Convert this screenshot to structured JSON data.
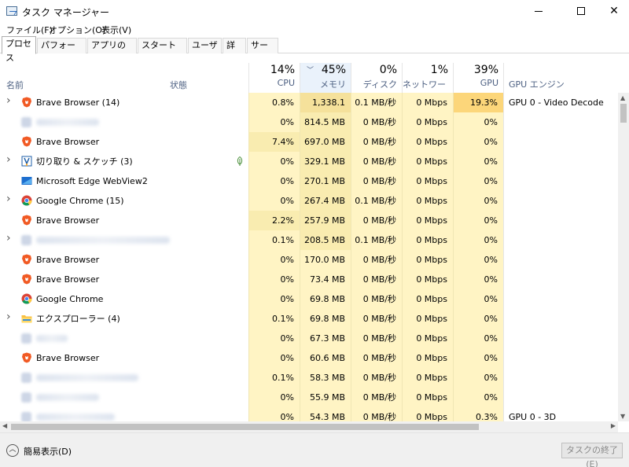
{
  "window": {
    "title": "タスク マネージャー"
  },
  "menu": [
    "ファイル(F)",
    "オプション(O)",
    "表示(V)"
  ],
  "tabs": [
    "プロセス",
    "パフォーマンス",
    "アプリの履歴",
    "スタートアップ",
    "ユーザー",
    "詳細",
    "サービス"
  ],
  "header": {
    "name": "名前",
    "status": "状態",
    "cpu": {
      "pct": "14%",
      "label": "CPU"
    },
    "memory": {
      "pct": "45%",
      "label": "メモリ"
    },
    "disk": {
      "pct": "0%",
      "label": "ディスク"
    },
    "network": {
      "pct": "1%",
      "label": "ネットワーク"
    },
    "gpu": {
      "pct": "39%",
      "label": "GPU"
    },
    "gpu_engine": {
      "label": "GPU エンジン"
    }
  },
  "rows": [
    {
      "name": "Brave Browser (14)",
      "icon": "brave-icon",
      "expand": true,
      "cpu": "0.8%",
      "mem": "1,338.1 MB",
      "disk": "0.1 MB/秒",
      "net": "0 Mbps",
      "gpu": "19.3%",
      "engine": "GPU 0 - Video Decode"
    },
    {
      "name": "",
      "icon": "blurred-icon",
      "expand": false,
      "cpu": "0%",
      "mem": "814.5 MB",
      "disk": "0 MB/秒",
      "net": "0 Mbps",
      "gpu": "0%",
      "engine": ""
    },
    {
      "name": "Brave Browser",
      "icon": "brave-icon",
      "expand": false,
      "cpu": "7.4%",
      "mem": "697.0 MB",
      "disk": "0 MB/秒",
      "net": "0 Mbps",
      "gpu": "0%",
      "engine": ""
    },
    {
      "name": "切り取り & スケッチ (3)",
      "icon": "snip-sketch-icon",
      "expand": true,
      "cpu": "0%",
      "mem": "329.1 MB",
      "disk": "0 MB/秒",
      "net": "0 Mbps",
      "gpu": "0%",
      "engine": ""
    },
    {
      "name": "Microsoft Edge WebView2",
      "icon": "edge-webview-icon",
      "expand": false,
      "cpu": "0%",
      "mem": "270.1 MB",
      "disk": "0 MB/秒",
      "net": "0 Mbps",
      "gpu": "0%",
      "engine": ""
    },
    {
      "name": "Google Chrome (15)",
      "icon": "chrome-icon",
      "expand": true,
      "cpu": "0%",
      "mem": "267.4 MB",
      "disk": "0.1 MB/秒",
      "net": "0 Mbps",
      "gpu": "0%",
      "engine": ""
    },
    {
      "name": "Brave Browser",
      "icon": "brave-icon",
      "expand": false,
      "cpu": "2.2%",
      "mem": "257.9 MB",
      "disk": "0 MB/秒",
      "net": "0 Mbps",
      "gpu": "0%",
      "engine": ""
    },
    {
      "name": "",
      "icon": "blurred-icon",
      "expand": true,
      "cpu": "0.1%",
      "mem": "208.5 MB",
      "disk": "0.1 MB/秒",
      "net": "0 Mbps",
      "gpu": "0%",
      "engine": ""
    },
    {
      "name": "Brave Browser",
      "icon": "brave-icon",
      "expand": false,
      "cpu": "0%",
      "mem": "170.0 MB",
      "disk": "0 MB/秒",
      "net": "0 Mbps",
      "gpu": "0%",
      "engine": ""
    },
    {
      "name": "Brave Browser",
      "icon": "brave-icon",
      "expand": false,
      "cpu": "0%",
      "mem": "73.4 MB",
      "disk": "0 MB/秒",
      "net": "0 Mbps",
      "gpu": "0%",
      "engine": ""
    },
    {
      "name": "Google Chrome",
      "icon": "chrome-icon",
      "expand": false,
      "cpu": "0%",
      "mem": "69.8 MB",
      "disk": "0 MB/秒",
      "net": "0 Mbps",
      "gpu": "0%",
      "engine": ""
    },
    {
      "name": "エクスプローラー (4)",
      "icon": "explorer-icon",
      "expand": true,
      "cpu": "0.1%",
      "mem": "69.8 MB",
      "disk": "0 MB/秒",
      "net": "0 Mbps",
      "gpu": "0%",
      "engine": ""
    },
    {
      "name": "",
      "icon": "blurred-icon",
      "expand": false,
      "cpu": "0%",
      "mem": "67.3 MB",
      "disk": "0 MB/秒",
      "net": "0 Mbps",
      "gpu": "0%",
      "engine": ""
    },
    {
      "name": "Brave Browser",
      "icon": "brave-icon",
      "expand": false,
      "cpu": "0%",
      "mem": "60.6 MB",
      "disk": "0 MB/秒",
      "net": "0 Mbps",
      "gpu": "0%",
      "engine": ""
    },
    {
      "name": "",
      "icon": "blurred-icon",
      "expand": false,
      "cpu": "0.1%",
      "mem": "58.3 MB",
      "disk": "0 MB/秒",
      "net": "0 Mbps",
      "gpu": "0%",
      "engine": ""
    },
    {
      "name": "",
      "icon": "blurred-icon",
      "expand": false,
      "cpu": "0%",
      "mem": "55.9 MB",
      "disk": "0 MB/秒",
      "net": "0 Mbps",
      "gpu": "0%",
      "engine": ""
    },
    {
      "name": "",
      "icon": "blurred-icon",
      "expand": false,
      "cpu": "0%",
      "mem": "54.3 MB",
      "disk": "0 MB/秒",
      "net": "0 Mbps",
      "gpu": "0.3%",
      "engine": "GPU 0 - 3D"
    }
  ],
  "footer": {
    "fewer_details": "簡易表示(D)",
    "end_task": "タスクの終了(E)"
  },
  "colors": {
    "heat_low": "#fff4c4",
    "heat_mid": "#f9ecb0",
    "heat_high": "#f5e19b",
    "heat_gpu": "#fcd67a",
    "header_label": "#4d6082"
  }
}
